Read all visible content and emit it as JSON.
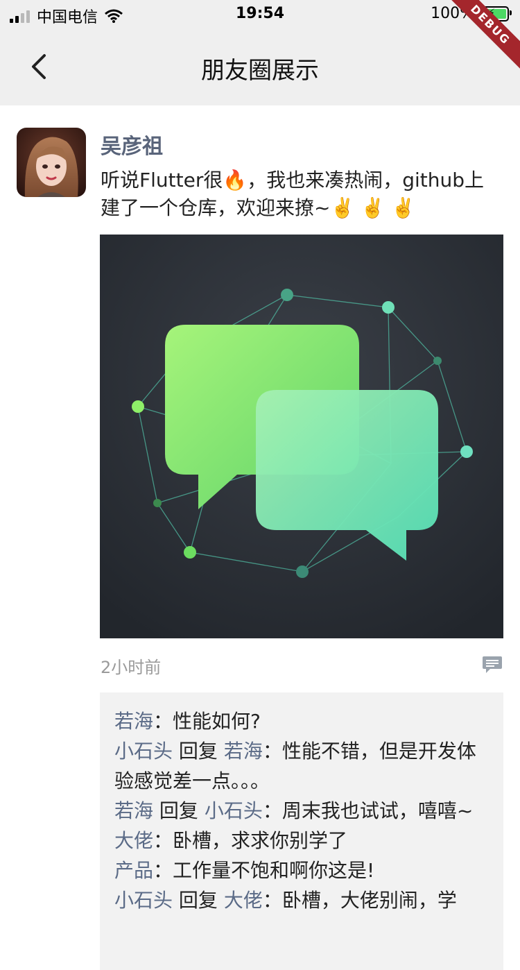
{
  "status_bar": {
    "carrier": "中国电信",
    "time": "19:54",
    "battery_percent": "100%"
  },
  "debug_banner": "DEBUG",
  "nav": {
    "title": "朋友圈展示",
    "back_icon": "chevron-left-icon"
  },
  "post": {
    "username": "吴彦祖",
    "content": "听说Flutter很🔥，我也来凑热闹，github上建了一个仓库，欢迎来撩~✌️ ✌️ ✌️",
    "time": "2小时前",
    "comment_icon": "comment-icon"
  },
  "comments": [
    {
      "from": "若海",
      "reply_word": "",
      "to": "",
      "sep": "：",
      "text": "性能如何?"
    },
    {
      "from": "小石头",
      "reply_word": " 回复 ",
      "to": "若海",
      "sep": "：",
      "text": "性能不错，但是开发体验感觉差一点。。。"
    },
    {
      "from": "若海",
      "reply_word": " 回复 ",
      "to": "小石头",
      "sep": "：",
      "text": "周末我也试试，嘻嘻~"
    },
    {
      "from": "大佬",
      "reply_word": "",
      "to": "",
      "sep": "：",
      "text": "卧槽，求求你别学了"
    },
    {
      "from": "产品",
      "reply_word": "",
      "to": "",
      "sep": "：",
      "text": "工作量不饱和啊你这是!"
    },
    {
      "from": "小石头",
      "reply_word": " 回复 ",
      "to": "大佬",
      "sep": "：",
      "text": "卧槽，大佬别闹，学"
    }
  ],
  "colors": {
    "nav_bg": "#efefef",
    "username": "#59647a",
    "comment_user": "#5b6b87",
    "comment_bg": "#f2f2f2",
    "debug_ribbon": "#a4262c"
  }
}
